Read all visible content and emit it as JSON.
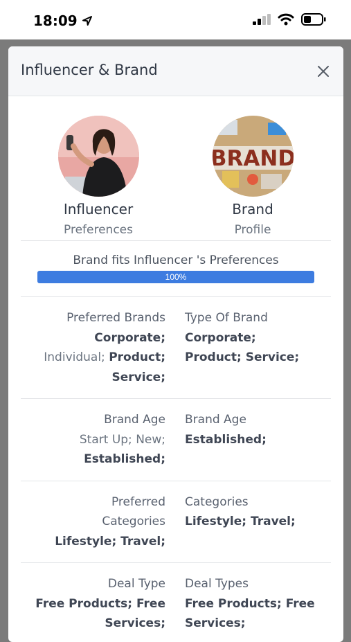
{
  "status": {
    "time": "18:09"
  },
  "modal": {
    "title": "Influencer & Brand"
  },
  "influencer": {
    "name": "Influencer",
    "sub": "Preferences"
  },
  "brand": {
    "name": "Brand",
    "sub": "Profile",
    "logo_text": "BRAND"
  },
  "match": {
    "label": "Brand fits Influencer 's Preferences",
    "percent_text": "100%",
    "fill_fraction": 1.0
  },
  "rows": [
    {
      "left_header": "Preferred Brands",
      "left_lines": [
        [
          "Corporate;"
        ],
        [
          "Individual;",
          "Product;"
        ],
        [
          "Service;"
        ]
      ],
      "right_header": "Type Of Brand",
      "right_lines": [
        "Corporate;",
        "Product; Service;"
      ]
    },
    {
      "left_header": "Brand Age",
      "left_lines": [
        "Start Up; New;",
        "Established;"
      ],
      "right_header": "Brand Age",
      "right_lines": [
        "Established;"
      ]
    },
    {
      "left_header": "Preferred",
      "left_header2": "Categories",
      "left_lines": [
        "Lifestyle; Travel;"
      ],
      "right_header": "Categories",
      "right_lines": [
        "Lifestyle; Travel;"
      ]
    },
    {
      "left_header": "Deal Type",
      "left_lines": [
        "Free Products; Free",
        "Services;"
      ],
      "right_header": "Deal Types",
      "right_lines": [
        "Free Products; Free",
        "Services;"
      ]
    }
  ],
  "colors": {
    "accent": "#3d7ce0",
    "text": "#2f3744",
    "muted": "#6b7480"
  }
}
